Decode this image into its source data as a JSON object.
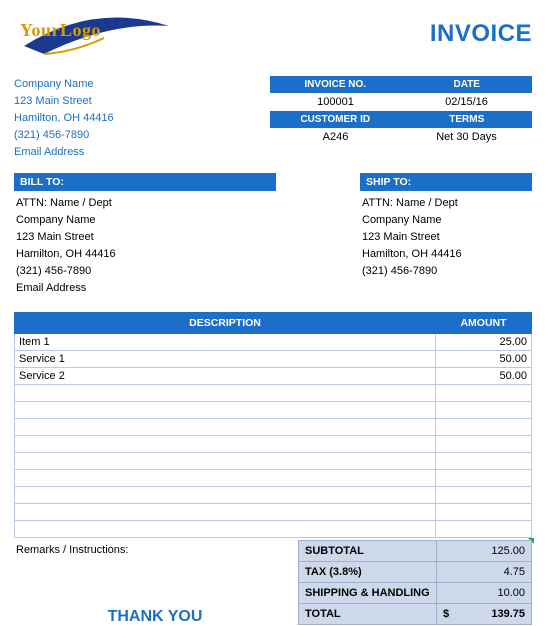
{
  "logo": {
    "line1": "Your",
    "line2": "Logo"
  },
  "title": "INVOICE",
  "company": {
    "name": "Company Name",
    "street": "123 Main Street",
    "city": "Hamilton, OH  44416",
    "phone": "(321) 456-7890",
    "email": "Email Address"
  },
  "meta": {
    "head_invoice": "INVOICE NO.",
    "head_date": "DATE",
    "invoice_no": "100001",
    "date": "02/15/16",
    "head_customer": "CUSTOMER ID",
    "head_terms": "TERMS",
    "customer_id": "A246",
    "terms": "Net 30 Days"
  },
  "bill": {
    "header": "BILL TO:",
    "attn": "ATTN: Name / Dept",
    "company": "Company Name",
    "street": "123 Main Street",
    "city": "Hamilton, OH  44416",
    "phone": "(321) 456-7890",
    "email": "Email Address"
  },
  "ship": {
    "header": "SHIP TO:",
    "attn": "ATTN: Name / Dept",
    "company": "Company Name",
    "street": "123 Main Street",
    "city": "Hamilton, OH  44416",
    "phone": "(321) 456-7890"
  },
  "items": {
    "head_desc": "DESCRIPTION",
    "head_amt": "AMOUNT",
    "rows": [
      {
        "desc": "Item 1",
        "amt": "25.00"
      },
      {
        "desc": "Service 1",
        "amt": "50.00"
      },
      {
        "desc": "Service 2",
        "amt": "50.00"
      },
      {
        "desc": "",
        "amt": ""
      },
      {
        "desc": "",
        "amt": ""
      },
      {
        "desc": "",
        "amt": ""
      },
      {
        "desc": "",
        "amt": ""
      },
      {
        "desc": "",
        "amt": ""
      },
      {
        "desc": "",
        "amt": ""
      },
      {
        "desc": "",
        "amt": ""
      },
      {
        "desc": "",
        "amt": ""
      },
      {
        "desc": "",
        "amt": ""
      }
    ]
  },
  "remarks": {
    "label": "Remarks / Instructions:"
  },
  "thank_you": "THANK YOU",
  "totals": {
    "subtotal_label": "SUBTOTAL",
    "subtotal": "125.00",
    "tax_label": "TAX (3.8%)",
    "tax": "4.75",
    "ship_label": "SHIPPING & HANDLING",
    "ship": "10.00",
    "total_label": "TOTAL",
    "currency": "$",
    "total": "139.75"
  }
}
